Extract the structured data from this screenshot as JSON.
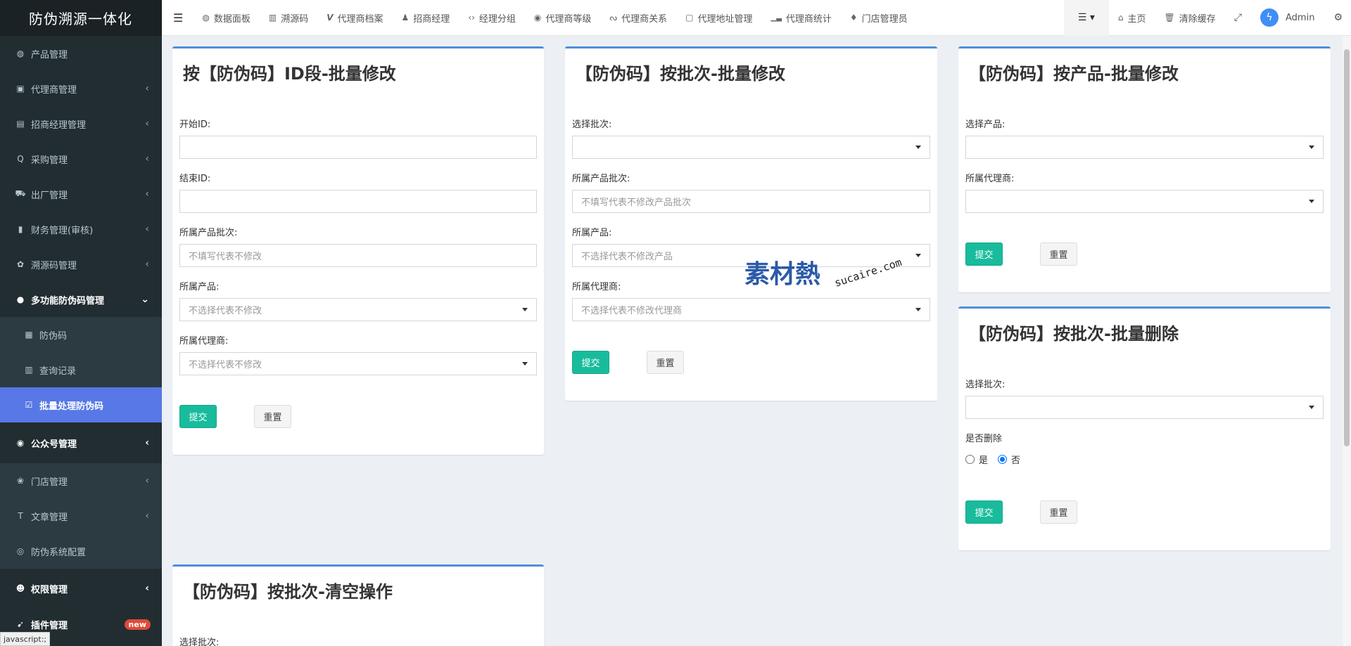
{
  "sidebar": {
    "logo": "防伪溯源一体化",
    "items": [
      {
        "label": "产品管理",
        "icon": "◍",
        "name": "product-mgmt",
        "chev": ""
      },
      {
        "label": "代理商管理",
        "icon": "▣",
        "name": "agent-mgmt",
        "chev": "‹"
      },
      {
        "label": "招商经理管理",
        "icon": "▤",
        "name": "manager-mgmt",
        "chev": "‹"
      },
      {
        "label": "采购管理",
        "icon": "Q",
        "name": "purchase-mgmt",
        "chev": "‹"
      },
      {
        "label": "出厂管理",
        "icon": "⛟",
        "name": "factory-mgmt",
        "chev": "‹"
      },
      {
        "label": "财务管理(审核)",
        "icon": "▮",
        "name": "finance-mgmt",
        "chev": "‹"
      },
      {
        "label": "溯源码管理",
        "icon": "✿",
        "name": "trace-code-mgmt",
        "chev": "‹"
      }
    ],
    "open_group": {
      "label": "多功能防伪码管理",
      "icon": "●",
      "chev": "⌄"
    },
    "sub_items": [
      {
        "label": "防伪码",
        "icon": "▦",
        "name": "anti-fake-code"
      },
      {
        "label": "查询记录",
        "icon": "▥",
        "name": "query-records"
      },
      {
        "label": "批量处理防伪码",
        "icon": "☑",
        "name": "batch-process"
      }
    ],
    "items2": [
      {
        "label": "公众号管理",
        "icon": "◉",
        "name": "wechat-mgmt",
        "chev": "‹",
        "group": true
      },
      {
        "label": "门店管理",
        "icon": "❀",
        "name": "store-mgmt",
        "chev": "‹",
        "group": false
      },
      {
        "label": "文章管理",
        "icon": "T",
        "name": "article-mgmt",
        "chev": "‹",
        "group": false
      },
      {
        "label": "防伪系统配置",
        "icon": "◎",
        "name": "system-config",
        "chev": "",
        "group": false
      }
    ],
    "items3": [
      {
        "label": "权限管理",
        "icon": "☻",
        "name": "permission-mgmt",
        "chev": "‹"
      },
      {
        "label": "插件管理",
        "icon": "➹",
        "name": "plugin-mgmt",
        "badge": "new"
      }
    ],
    "status_text": "javascript:;"
  },
  "topbar": {
    "nav": [
      {
        "label": "数据面板",
        "icon": "◍",
        "name": "dashboard"
      },
      {
        "label": "溯源码",
        "icon": "▥",
        "name": "trace-code"
      },
      {
        "label": "代理商档案",
        "icon": "V",
        "name": "agent-archive"
      },
      {
        "label": "招商经理",
        "icon": "♟",
        "name": "manager"
      },
      {
        "label": "经理分组",
        "icon": "‹›",
        "name": "manager-group"
      },
      {
        "label": "代理商等级",
        "icon": "◉",
        "name": "agent-level"
      },
      {
        "label": "代理商关系",
        "icon": "ᔓ",
        "name": "agent-relation"
      },
      {
        "label": "代理地址管理",
        "icon": "▢",
        "name": "agent-address"
      },
      {
        "label": "代理商统计",
        "icon": "▁▃",
        "name": "agent-stats"
      },
      {
        "label": "门店管理员",
        "icon": "♦",
        "name": "store-admin"
      }
    ],
    "home": "主页",
    "clear_cache": "清除缓存",
    "admin": "Admin"
  },
  "forms": {
    "by_id": {
      "title": "按【防伪码】ID段-批量修改",
      "start_label": "开始ID:",
      "start_value": "",
      "end_label": "结束ID:",
      "end_value": "",
      "batch_label": "所属产品批次:",
      "batch_placeholder": "不填写代表不修改",
      "product_label": "所属产品:",
      "product_placeholder": "不选择代表不修改",
      "agent_label": "所属代理商:",
      "agent_placeholder": "不选择代表不修改",
      "submit": "提交",
      "reset": "重置"
    },
    "by_batch": {
      "title": "【防伪码】按批次-批量修改",
      "select_batch_label": "选择批次:",
      "select_batch_value": "",
      "batch_label": "所属产品批次:",
      "batch_placeholder": "不填写代表不修改产品批次",
      "product_label": "所属产品:",
      "product_placeholder": "不选择代表不修改产品",
      "agent_label": "所属代理商:",
      "agent_placeholder": "不选择代表不修改代理商",
      "submit": "提交",
      "reset": "重置"
    },
    "by_product": {
      "title": "【防伪码】按产品-批量修改",
      "product_label": "选择产品:",
      "product_value": "",
      "agent_label": "所属代理商:",
      "agent_value": "",
      "submit": "提交",
      "reset": "重置"
    },
    "delete_batch": {
      "title": "【防伪码】按批次-批量删除",
      "select_batch_label": "选择批次:",
      "select_batch_value": "",
      "delete_label": "是否删除",
      "yes": "是",
      "no": "否",
      "submit": "提交",
      "reset": "重置"
    },
    "clear_batch": {
      "title": "【防伪码】按批次-清空操作",
      "select_batch_label": "选择批次:"
    }
  },
  "watermark": {
    "cn": "素材熱",
    "en": "sucaire.com"
  },
  "colors": {
    "sidebar_bg": "#222d32",
    "active": "#5778e6",
    "submit": "#18bc9c",
    "box_border": "#4f8fd8"
  }
}
